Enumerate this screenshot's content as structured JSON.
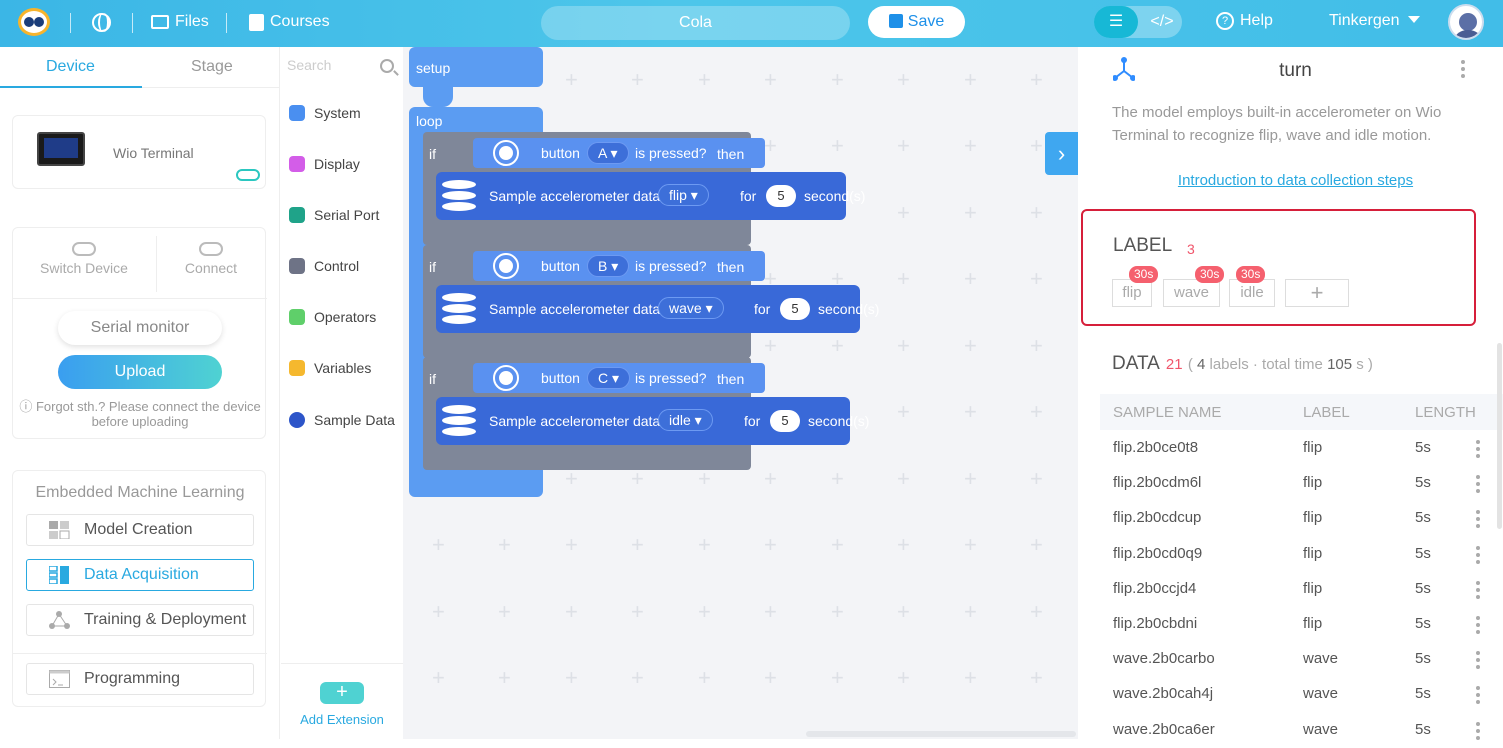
{
  "topbar": {
    "files_label": "Files",
    "courses_label": "Courses",
    "project_name": "Cola",
    "save_label": "Save",
    "code_toggle": "</>",
    "help_label": "Help",
    "user_name": "Tinkergen"
  },
  "left": {
    "tabs": [
      "Device",
      "Stage"
    ],
    "device_name": "Wio Terminal",
    "switch_device": "Switch Device",
    "connect": "Connect",
    "serial_monitor": "Serial monitor",
    "upload": "Upload",
    "forgot_line1": "Forgot sth.? Please connect the device",
    "forgot_line2": "before uploading",
    "eml_title": "Embedded Machine Learning",
    "eml_items": [
      "Model Creation",
      "Data Acquisition",
      "Training & Deployment",
      "Programming"
    ]
  },
  "categories": {
    "search_placeholder": "Search",
    "items": [
      {
        "label": "System",
        "color": "#4a8ff0"
      },
      {
        "label": "Display",
        "color": "#d35de8"
      },
      {
        "label": "Serial Port",
        "color": "#1fa389"
      },
      {
        "label": "Control",
        "color": "#6e7386"
      },
      {
        "label": "Operators",
        "color": "#5fcf6a"
      },
      {
        "label": "Variables",
        "color": "#f5b82e"
      },
      {
        "label": "Sample Data",
        "color": "#2d55c9"
      }
    ],
    "add_extension": "Add Extension"
  },
  "blocks": {
    "setup": "setup",
    "loop": "loop",
    "if_label": "if",
    "then_label": "then",
    "button_word": "button",
    "is_pressed": "is pressed?",
    "sample_text": "Sample accelerometer data",
    "for_word": "for",
    "seconds": "second(s)",
    "rows": [
      {
        "button": "A",
        "label": "flip",
        "secs": "5"
      },
      {
        "button": "B",
        "label": "wave",
        "secs": "5"
      },
      {
        "button": "C",
        "label": "idle",
        "secs": "5"
      }
    ]
  },
  "right": {
    "title": "turn",
    "description": "The model employs built-in accelerometer on Wio Terminal to recognize flip, wave and idle motion.",
    "intro_link": "Introduction to data collection steps",
    "label_header": "LABEL",
    "label_count": "3",
    "labels": [
      {
        "name": "flip",
        "time": "30s"
      },
      {
        "name": "wave",
        "time": "30s"
      },
      {
        "name": "idle",
        "time": "30s"
      }
    ],
    "add_label": "+",
    "data_header": "DATA",
    "data_count": "21",
    "data_sub_pre": "( ",
    "data_labels_num": "4",
    "data_sub_mid": " labels · total time ",
    "data_time_num": "105",
    "data_sub_post": " s )",
    "columns": [
      "SAMPLE NAME",
      "LABEL",
      "LENGTH"
    ],
    "rows": [
      [
        "flip.2b0ce0t8",
        "flip",
        "5s"
      ],
      [
        "flip.2b0cdm6l",
        "flip",
        "5s"
      ],
      [
        "flip.2b0cdcup",
        "flip",
        "5s"
      ],
      [
        "flip.2b0cd0q9",
        "flip",
        "5s"
      ],
      [
        "flip.2b0ccjd4",
        "flip",
        "5s"
      ],
      [
        "flip.2b0cbdni",
        "flip",
        "5s"
      ],
      [
        "wave.2b0carbo",
        "wave",
        "5s"
      ],
      [
        "wave.2b0cah4j",
        "wave",
        "5s"
      ],
      [
        "wave.2b0ca6er",
        "wave",
        "5s"
      ]
    ]
  }
}
